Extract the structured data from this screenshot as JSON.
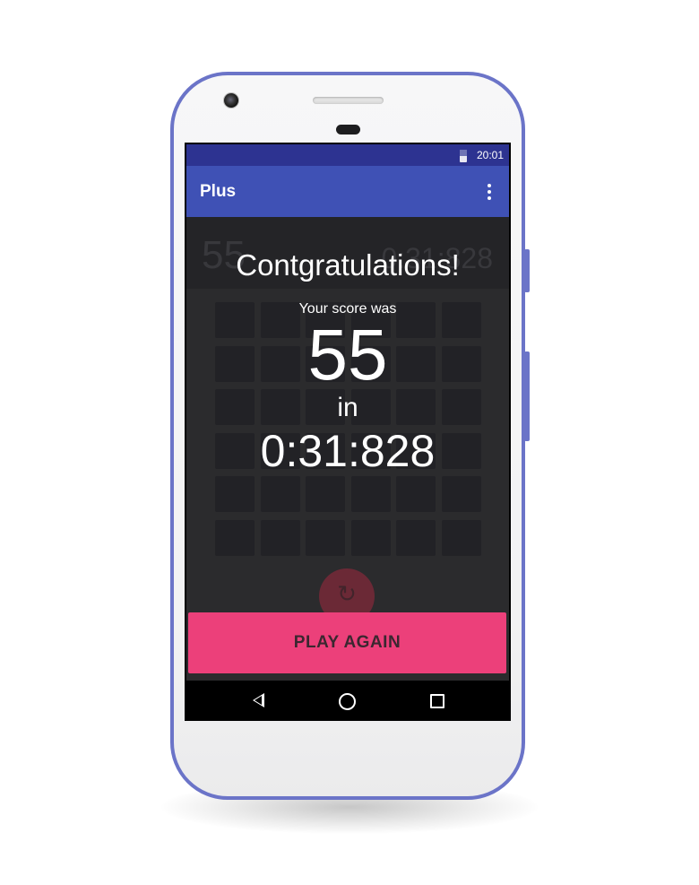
{
  "status_bar": {
    "time": "20:01",
    "battery_icon": "battery-icon"
  },
  "app_bar": {
    "title": "Plus",
    "menu_icon": "more-vert-icon"
  },
  "background_game": {
    "score": "55",
    "timer": "0:31:828",
    "grid_rows": 6,
    "grid_cols": 6,
    "reset_icon": "refresh-icon"
  },
  "dialog": {
    "heading": "Contgratulations!",
    "score_label": "Your score was",
    "score": "55",
    "in_label": "in",
    "time": "0:31:828"
  },
  "play_again_label": "PLAY AGAIN",
  "navigation": {
    "back_icon": "back-triangle-icon",
    "home_icon": "home-circle-icon",
    "recents_icon": "recents-square-icon"
  },
  "colors": {
    "status_bar": "#2d3391",
    "app_bar": "#3f51b5",
    "background": "#2b2b2d",
    "accent": "#ec407a",
    "phone_frame": "#6b74c8"
  }
}
